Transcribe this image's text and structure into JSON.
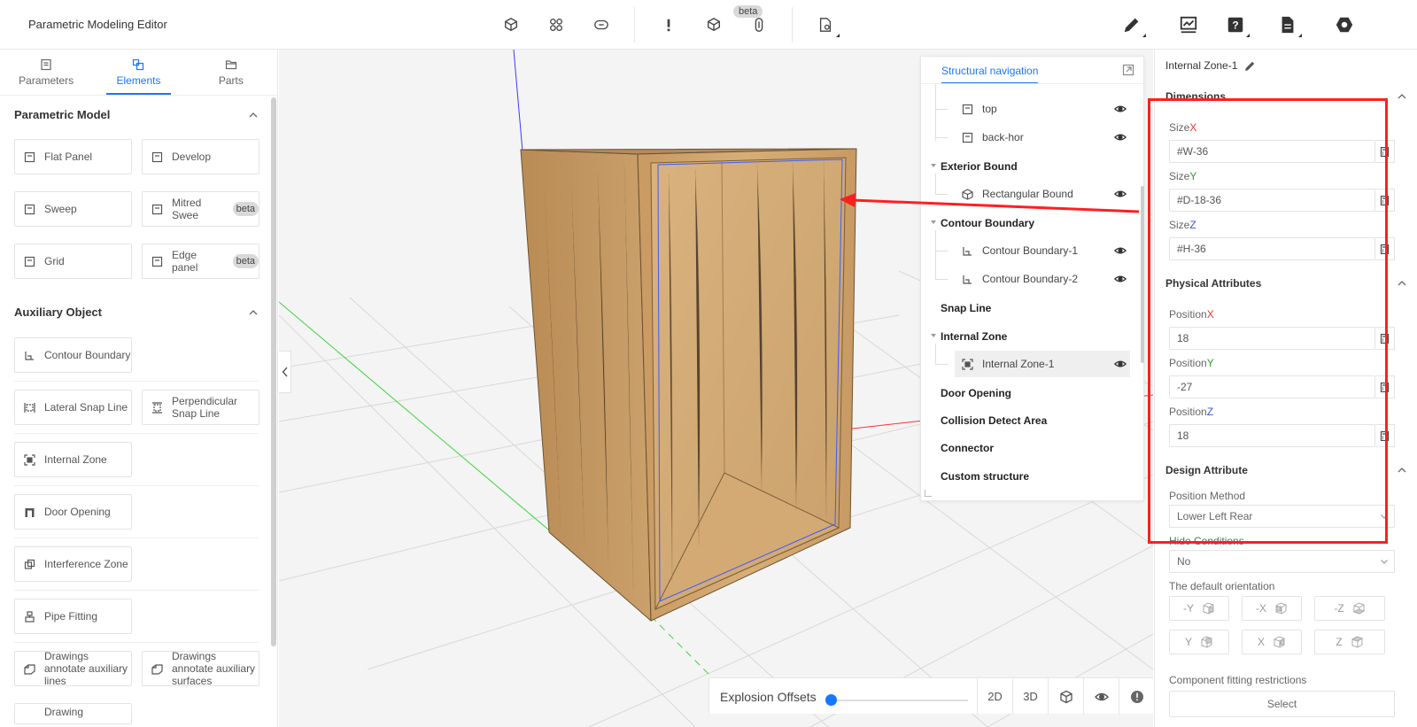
{
  "app": {
    "title": "Parametric Modeling Editor"
  },
  "toolbar": {
    "beta_badge": "beta"
  },
  "left_panel": {
    "tabs": [
      {
        "label": "Parameters",
        "icon": "document-icon"
      },
      {
        "label": "Elements",
        "icon": "elements-icon",
        "active": true
      },
      {
        "label": "Parts",
        "icon": "folder-icon"
      }
    ],
    "sections": {
      "parametric_model": "Parametric Model",
      "auxiliary_object": "Auxiliary Object"
    },
    "parametric_items": [
      {
        "label": "Flat Panel"
      },
      {
        "label": "Develop"
      },
      {
        "label": "Sweep"
      },
      {
        "label": "Mitred Swee",
        "badge": "beta"
      },
      {
        "label": "Grid"
      },
      {
        "label": "Edge panel",
        "badge": "beta"
      }
    ],
    "auxiliary_items": [
      {
        "label": "Contour Boundary"
      },
      {
        "label": "Lateral Snap Line"
      },
      {
        "label": "Perpendicular Snap Line"
      },
      {
        "label": "Internal Zone"
      },
      {
        "label": "Door Opening"
      },
      {
        "label": "Interference Zone"
      },
      {
        "label": "Pipe Fitting"
      },
      {
        "label": "Drawings annotate auxiliary lines"
      },
      {
        "label": "Drawings annotate auxiliary surfaces"
      },
      {
        "label": "Drawing"
      }
    ]
  },
  "viewport": {
    "bottom": {
      "explosion_label": "Explosion Offsets",
      "explosion_value": 0,
      "btn_2d": "2D",
      "btn_3d": "3D"
    }
  },
  "structural_nav": {
    "tab": "Structural navigation",
    "items": {
      "top": "top",
      "back_hor": "back-hor",
      "exterior_bound": "Exterior Bound",
      "rectangular_bound": "Rectangular Bound",
      "contour_boundary": "Contour Boundary",
      "contour_boundary_1": "Contour Boundary-1",
      "contour_boundary_2": "Contour Boundary-2",
      "snap_line": "Snap Line",
      "internal_zone": "Internal Zone",
      "internal_zone_1": "Internal Zone-1",
      "door_opening": "Door Opening",
      "collision_detect_area": "Collision Detect Area",
      "connector": "Connector",
      "custom_structure": "Custom structure"
    }
  },
  "right_panel": {
    "title": "Internal Zone-1",
    "dimensions_header": "Dimensions",
    "size_label": "Size",
    "axis_x": "X",
    "axis_y": "Y",
    "axis_z": "Z",
    "size_x": "#W-36",
    "size_y": "#D-18-36",
    "size_z": "#H-36",
    "physical_header": "Physical Attributes",
    "position_label": "Position",
    "position_x": "18",
    "position_y": "-27",
    "position_z": "18",
    "design_header": "Design Attribute",
    "position_method_label": "Position Method",
    "position_method_value": "Lower Left Rear",
    "hide_conditions_label": "Hide Conditions",
    "hide_conditions_value": "No",
    "default_orientation_label": "The default orientation",
    "orientations": [
      "-Y",
      "-X",
      "-Z",
      "Y",
      "X",
      "Z"
    ],
    "fitting_label": "Component fitting restrictions",
    "select_button": "Select"
  },
  "colors": {
    "accent": "#1677ff",
    "annotation": "#ff1f1f",
    "axis_x": "#e53935",
    "axis_y": "#2e9d2e",
    "axis_z": "#3f51d6",
    "wood": "#c9a06a"
  }
}
